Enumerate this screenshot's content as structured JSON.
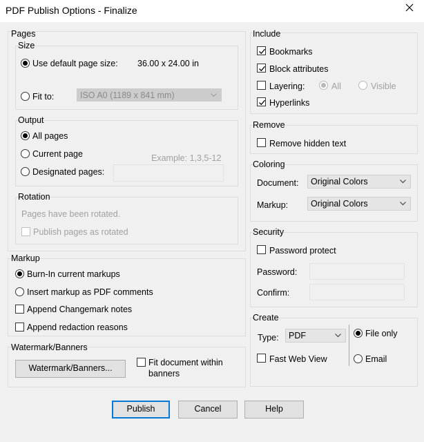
{
  "window": {
    "title": "PDF Publish Options - Finalize",
    "close_icon": "close-icon"
  },
  "pages": {
    "title": "Pages",
    "size": {
      "title": "Size",
      "default_label": "Use default page size:",
      "default_value": "36.00 x 24.00 in",
      "fit_label": "Fit to:",
      "fit_value": "ISO A0 (1189 x 841 mm)"
    },
    "output": {
      "title": "Output",
      "all_label": "All pages",
      "current_label": "Current page",
      "designated_label": "Designated pages:",
      "designated_placeholder": "Example: 1,3,5-12",
      "designated_value": ""
    },
    "rotation": {
      "title": "Rotation",
      "status": "Pages have been rotated.",
      "publish_rotated_label": "Publish pages as rotated"
    }
  },
  "markup": {
    "title": "Markup",
    "burn_in_label": "Burn-In current markups",
    "insert_label": "Insert markup as PDF comments",
    "append_changemark_label": "Append Changemark notes",
    "append_redaction_label": "Append redaction reasons"
  },
  "watermark": {
    "title": "Watermark/Banners",
    "button_label": "Watermark/Banners...",
    "fit_label_line1": "Fit document within",
    "fit_label_line2": "banners"
  },
  "include": {
    "title": "Include",
    "bookmarks_label": "Bookmarks",
    "block_attributes_label": "Block attributes",
    "layering_label": "Layering:",
    "layering_all_label": "All",
    "layering_visible_label": "Visible",
    "hyperlinks_label": "Hyperlinks"
  },
  "remove": {
    "title": "Remove",
    "hidden_text_label": "Remove hidden text"
  },
  "coloring": {
    "title": "Coloring",
    "document_label": "Document:",
    "document_value": "Original Colors",
    "markup_label": "Markup:",
    "markup_value": "Original Colors"
  },
  "security": {
    "title": "Security",
    "password_protect_label": "Password protect",
    "password_label": "Password:",
    "password_value": "",
    "confirm_label": "Confirm:",
    "confirm_value": ""
  },
  "create": {
    "title": "Create",
    "type_label": "Type:",
    "type_value": "PDF",
    "fast_web_label": "Fast Web View",
    "file_only_label": "File only",
    "email_label": "Email"
  },
  "footer": {
    "publish_label": "Publish",
    "cancel_label": "Cancel",
    "help_label": "Help"
  },
  "state": {
    "size_default": true,
    "output_all": true,
    "markup_burn_in": true,
    "bookmarks": true,
    "block_attributes": true,
    "layering": false,
    "layering_all": true,
    "hyperlinks": true,
    "remove_hidden_text": false,
    "password_protect": false,
    "fast_web_view": false,
    "create_file_only": true
  }
}
